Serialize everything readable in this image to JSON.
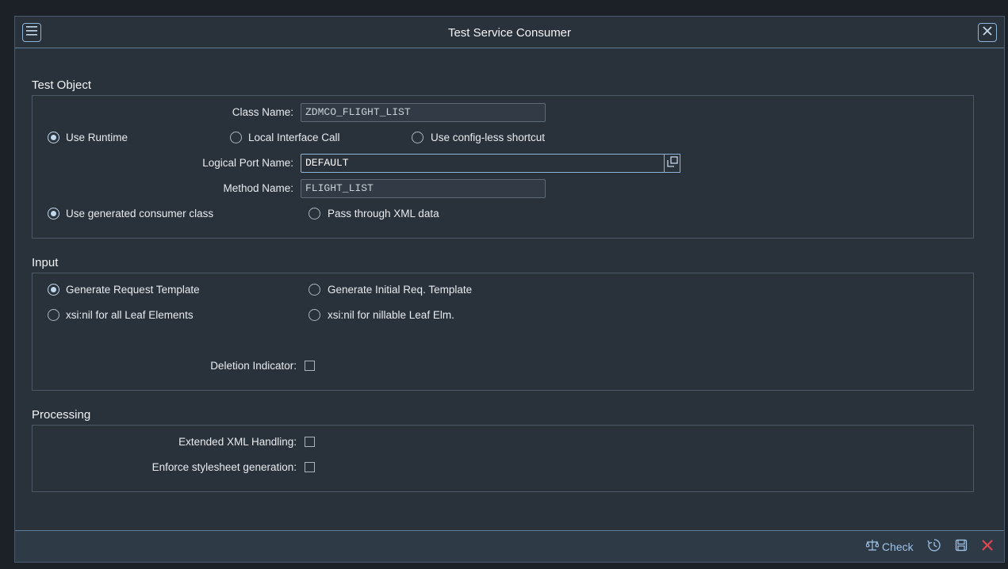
{
  "dialog": {
    "title": "Test Service Consumer"
  },
  "test_object": {
    "section_title": "Test Object",
    "class_name_label": "Class Name:",
    "class_name_value": "ZDMCO_FLIGHT_LIST",
    "radio_use_runtime": "Use Runtime",
    "radio_local_interface": "Local Interface Call",
    "radio_config_less": "Use config-less shortcut",
    "logical_port_label": "Logical Port Name:",
    "logical_port_value": "DEFAULT",
    "method_name_label": "Method Name:",
    "method_name_value": "FLIGHT_LIST",
    "radio_generated_class": "Use generated consumer class",
    "radio_pass_xml": "Pass through XML data"
  },
  "input": {
    "section_title": "Input",
    "radio_gen_request": "Generate Request Template",
    "radio_gen_initial": "Generate Initial Req. Template",
    "radio_xsi_all": "xsi:nil for all Leaf Elements",
    "radio_xsi_nillable": "xsi:nil for nillable Leaf Elm.",
    "deletion_label": "Deletion Indicator:"
  },
  "processing": {
    "section_title": "Processing",
    "extended_xml_label": "Extended XML Handling:",
    "enforce_stylesheet_label": "Enforce stylesheet generation:"
  },
  "footer": {
    "check_label": "Check"
  },
  "colors": {
    "background": "#29313a",
    "accent": "#9fc3e6",
    "close_red": "#e0484f"
  }
}
